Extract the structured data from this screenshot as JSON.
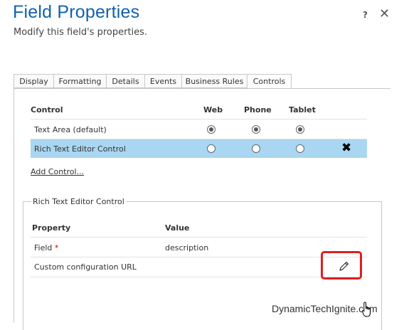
{
  "dialog": {
    "title": "Field Properties",
    "subtitle": "Modify this field's properties.",
    "help_label": "?",
    "close_label": "✕"
  },
  "tabs": [
    {
      "label": "Display",
      "active": false
    },
    {
      "label": "Formatting",
      "active": false
    },
    {
      "label": "Details",
      "active": false
    },
    {
      "label": "Events",
      "active": false
    },
    {
      "label": "Business Rules",
      "active": false
    },
    {
      "label": "Controls",
      "active": true
    }
  ],
  "controls_table": {
    "headers": [
      "Control",
      "Web",
      "Phone",
      "Tablet"
    ],
    "rows": [
      {
        "label": "Text Area (default)",
        "web": true,
        "phone": true,
        "tablet": true,
        "selected": false
      },
      {
        "label": "Rich Text Editor Control",
        "web": false,
        "phone": false,
        "tablet": false,
        "selected": true
      }
    ],
    "remove_label": "✖",
    "add_control_label": "Add Control..."
  },
  "properties_section": {
    "legend": "Rich Text Editor Control",
    "headers": [
      "Property",
      "Value"
    ],
    "rows": [
      {
        "property": "Field",
        "required_marker": "*",
        "value": "description"
      },
      {
        "property": "Custom configuration URL",
        "value": ""
      }
    ]
  },
  "watermark": "DynamicTechIgnite.com",
  "colors": {
    "title": "#1261ad",
    "selected_row": "#a9d6f0",
    "highlight_box": "#e01e1e",
    "required": "#cc0000"
  }
}
